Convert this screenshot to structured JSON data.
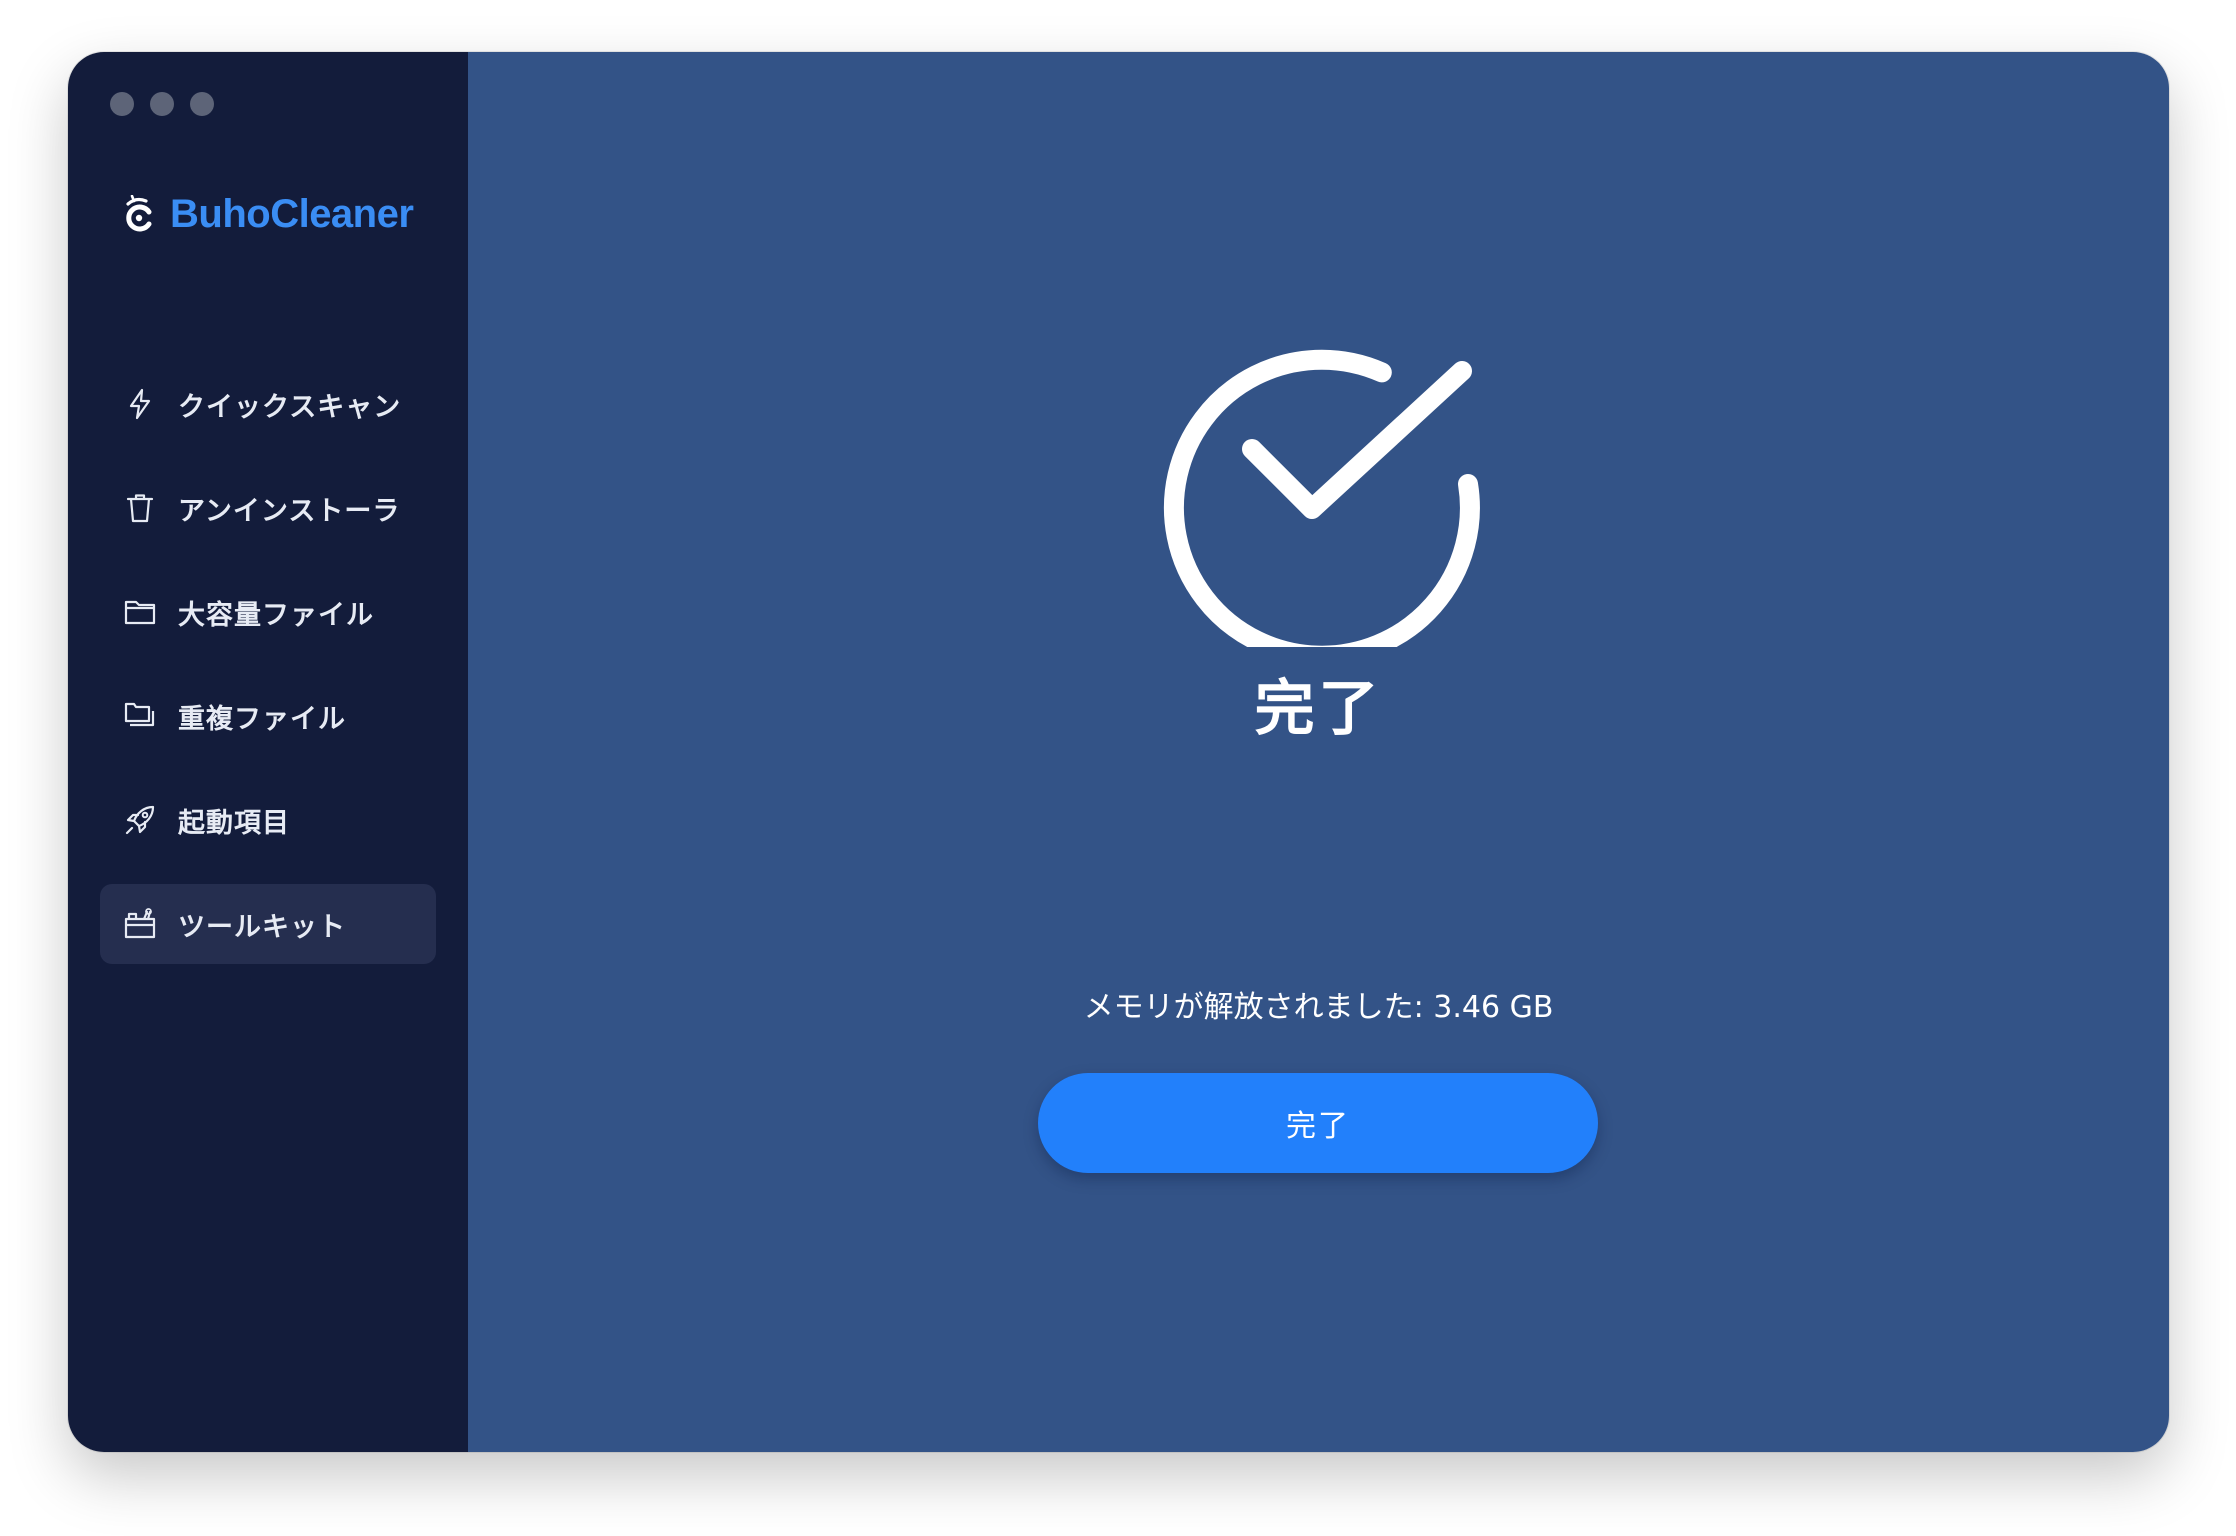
{
  "app": {
    "name": "BuhoCleaner",
    "brand_color": "#3a8df4"
  },
  "window_controls": [
    "close",
    "minimize",
    "zoom"
  ],
  "sidebar": {
    "active_index": 5,
    "items": [
      {
        "label": "クイックスキャン",
        "icon": "bolt-icon"
      },
      {
        "label": "アンインストーラ",
        "icon": "trash-icon"
      },
      {
        "label": "大容量ファイル",
        "icon": "folder-icon"
      },
      {
        "label": "重複ファイル",
        "icon": "duplicate-folder-icon"
      },
      {
        "label": "起動項目",
        "icon": "rocket-icon"
      },
      {
        "label": "ツールキット",
        "icon": "toolkit-icon"
      }
    ]
  },
  "main": {
    "icon": "check-circle-icon",
    "title": "完了",
    "status_text": "メモリが解放されました: 3.46 GB",
    "button_label": "完了",
    "button_color": "#2280fb",
    "background_color": "#335387"
  }
}
